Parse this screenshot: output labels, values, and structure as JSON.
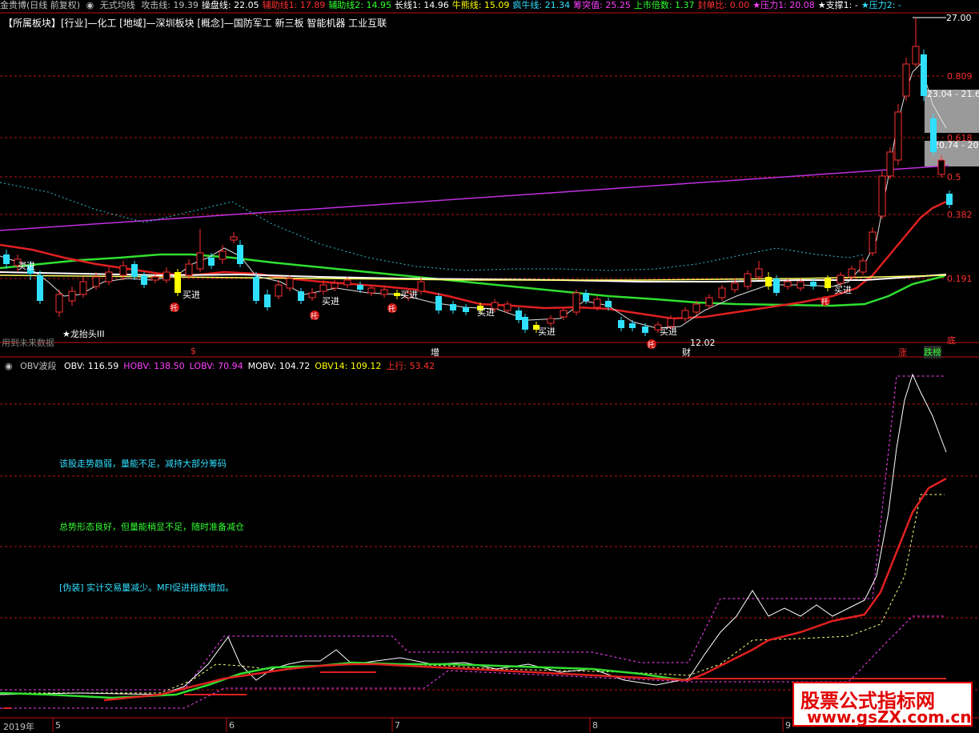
{
  "top_bar": {
    "app": "金贵博(日线 前复权)",
    "indicator": "无式均线",
    "items": [
      {
        "label": "攻击线: 19.39",
        "color": "#c0c0c0"
      },
      {
        "label": "操盘线: 22.05",
        "color": "#ffffff"
      },
      {
        "label": "辅助线1: 17.89",
        "color": "#ff3030"
      },
      {
        "label": "辅助线2: 14.95",
        "color": "#30ff30"
      },
      {
        "label": "长线1: 14.96",
        "color": "#ffffff"
      },
      {
        "label": "牛熊线: 15.09",
        "color": "#ffff00"
      },
      {
        "label": "疯牛线: 21.34",
        "color": "#30e0ff"
      },
      {
        "label": "筹突值: 25.25",
        "color": "#ff40ff"
      },
      {
        "label": "上市倍数: 1.37",
        "color": "#30ff30"
      },
      {
        "label": "封单比: 0.00",
        "color": "#ff3030"
      },
      {
        "label": "★压力1: 20.08",
        "color": "#ff40ff"
      },
      {
        "label": "★支撑1: -",
        "color": "#ffffff"
      },
      {
        "label": "★压力2: -",
        "color": "#30e0ff"
      }
    ]
  },
  "sector": "【所属板块】[行业]—化工 [地域]—深圳板块 [概念]—国防军工 新三板 智能机器 工业互联",
  "fib_levels": [
    "0.809",
    "0.618",
    "0.5",
    "0.382",
    "0.191"
  ],
  "price_labels": {
    "high": "27.00",
    "low": "12.02",
    "box1": "23.04 - 21.6",
    "box2": "20.74 - 20"
  },
  "signals": {
    "buy": "买进",
    "tuo": "托",
    "dragon": "★龙抬头III",
    "future_data": "用到未来数据",
    "bottom": "底",
    "markers": [
      "$",
      "增",
      "财",
      "涨",
      "跌榜"
    ]
  },
  "obv": {
    "name": "OBV波段",
    "items": [
      {
        "label": "OBV: 116.59",
        "color": "#ffffff"
      },
      {
        "label": "HOBV: 138.50",
        "color": "#ff40ff"
      },
      {
        "label": "LOBV: 70.94",
        "color": "#ff40ff"
      },
      {
        "label": "MOBV: 104.72",
        "color": "#ffffff"
      },
      {
        "label": "OBV14: 109.12",
        "color": "#ffff00"
      },
      {
        "label": "上行: 53.42",
        "color": "#ff3030"
      }
    ]
  },
  "comments": [
    {
      "text": "该股走势趋弱，量能不足，减持大部分筹码",
      "color": "#30e0ff"
    },
    {
      "text": "总势形态良好，但量能稍显不足，随时准备减仓",
      "color": "#30ff30"
    },
    {
      "text": "[伪装] 实计交易量减少。MFI促进指数增加。",
      "color": "#30e0ff"
    }
  ],
  "months": [
    "2019年",
    "5",
    "6",
    "7",
    "8",
    "9"
  ],
  "watermark": {
    "title": "股票公式指标网",
    "url": "www.gsZX.com.cn"
  },
  "colors": {
    "bg": "#000000",
    "grid": "#c01010",
    "up": "#ff3030",
    "down": "#30e0ff"
  }
}
